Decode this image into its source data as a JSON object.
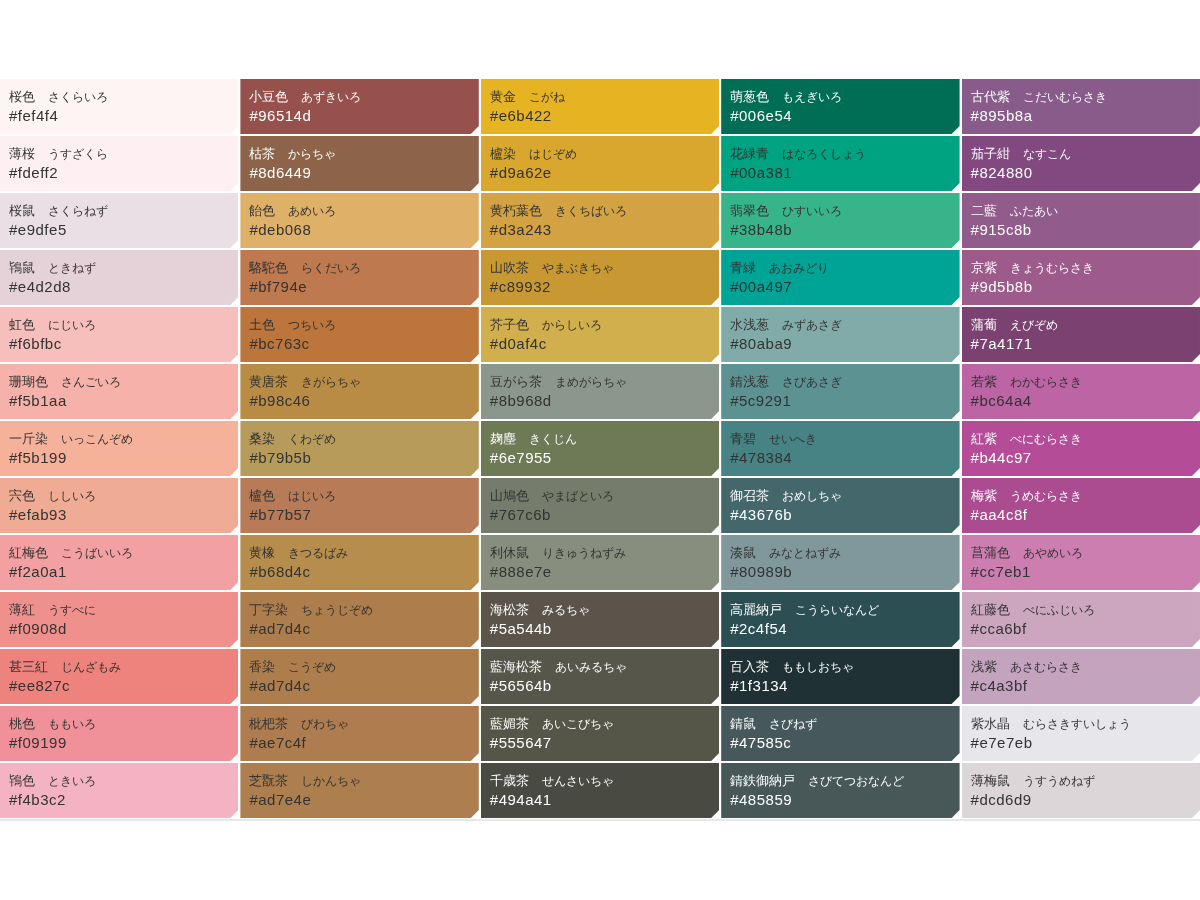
{
  "columns": [
    {
      "swatches": [
        {
          "name": "桜色",
          "reading": "さくらいろ",
          "hex": "#fef4f4",
          "color": "#fef4f4",
          "light_label": false
        },
        {
          "name": "薄桜",
          "reading": "うすざくら",
          "hex": "#fdeff2",
          "color": "#fdeff2",
          "light_label": false
        },
        {
          "name": "桜鼠",
          "reading": "さくらねず",
          "hex": "#e9dfe5",
          "color": "#e9dfe5",
          "light_label": false
        },
        {
          "name": "鴇鼠",
          "reading": "ときねず",
          "hex": "#e4d2d8",
          "color": "#e4d2d8",
          "light_label": false
        },
        {
          "name": "虹色",
          "reading": "にじいろ",
          "hex": "#f6bfbc",
          "color": "#f6bfbc",
          "light_label": false
        },
        {
          "name": "珊瑚色",
          "reading": "さんごいろ",
          "hex": "#f5b1aa",
          "color": "#f5b1aa",
          "light_label": false
        },
        {
          "name": "一斤染",
          "reading": "いっこんぞめ",
          "hex": "#f5b199",
          "color": "#f5b199",
          "light_label": false
        },
        {
          "name": "宍色",
          "reading": "ししいろ",
          "hex": "#efab93",
          "color": "#efab93",
          "light_label": false
        },
        {
          "name": "紅梅色",
          "reading": "こうばいいろ",
          "hex": "#f2a0a1",
          "color": "#f2a0a1",
          "light_label": false
        },
        {
          "name": "薄紅",
          "reading": "うすべに",
          "hex": "#f0908d",
          "color": "#f0908d",
          "light_label": false
        },
        {
          "name": "甚三紅",
          "reading": "じんざもみ",
          "hex": "#ee827c",
          "color": "#ee827c",
          "light_label": false
        },
        {
          "name": "桃色",
          "reading": "ももいろ",
          "hex": "#f09199",
          "color": "#f09199",
          "light_label": false
        },
        {
          "name": "鴇色",
          "reading": "ときいろ",
          "hex": "#f4b3c2",
          "color": "#f4b3c2",
          "light_label": false
        }
      ]
    },
    {
      "swatches": [
        {
          "name": "小豆色",
          "reading": "あずきいろ",
          "hex": "#96514d",
          "color": "#96514d",
          "light_label": true
        },
        {
          "name": "枯茶",
          "reading": "からちゃ",
          "hex": "#8d6449",
          "color": "#8d6449",
          "light_label": true
        },
        {
          "name": "飴色",
          "reading": "あめいろ",
          "hex": "#deb068",
          "color": "#deb068",
          "light_label": false
        },
        {
          "name": "駱駝色",
          "reading": "らくだいろ",
          "hex": "#bf794e",
          "color": "#bf794e",
          "light_label": false
        },
        {
          "name": "土色",
          "reading": "つちいろ",
          "hex": "#bc763c",
          "color": "#bc763c",
          "light_label": false
        },
        {
          "name": "黄唐茶",
          "reading": "きがらちゃ",
          "hex": "#b98c46",
          "color": "#b98c46",
          "light_label": false
        },
        {
          "name": "桑染",
          "reading": "くわぞめ",
          "hex": "#b79b5b",
          "color": "#b79b5b",
          "light_label": false
        },
        {
          "name": "櫨色",
          "reading": "はじいろ",
          "hex": "#b77b57",
          "color": "#b77b57",
          "light_label": false
        },
        {
          "name": "黄橡",
          "reading": "きつるばみ",
          "hex": "#b68d4c",
          "color": "#b68d4c",
          "light_label": false
        },
        {
          "name": "丁字染",
          "reading": "ちょうじぞめ",
          "hex": "#ad7d4c",
          "color": "#ad7d4c",
          "light_label": false
        },
        {
          "name": "香染",
          "reading": "こうぞめ",
          "hex": "#ad7d4c",
          "color": "#ad7d4c",
          "light_label": false
        },
        {
          "name": "枇杷茶",
          "reading": "びわちゃ",
          "hex": "#ae7c4f",
          "color": "#ae7c4f",
          "light_label": false
        },
        {
          "name": "芝翫茶",
          "reading": "しかんちゃ",
          "hex": "#ad7e4e",
          "color": "#ad7e4e",
          "light_label": false
        }
      ]
    },
    {
      "swatches": [
        {
          "name": "黄金",
          "reading": "こがね",
          "hex": "#e6b422",
          "color": "#e6b422",
          "light_label": false
        },
        {
          "name": "櫨染",
          "reading": "はじぞめ",
          "hex": "#d9a62e",
          "color": "#d9a62e",
          "light_label": false
        },
        {
          "name": "黄朽葉色",
          "reading": "きくちばいろ",
          "hex": "#d3a243",
          "color": "#d3a243",
          "light_label": false
        },
        {
          "name": "山吹茶",
          "reading": "やまぶきちゃ",
          "hex": "#c89932",
          "color": "#c89932",
          "light_label": false
        },
        {
          "name": "芥子色",
          "reading": "からしいろ",
          "hex": "#d0af4c",
          "color": "#d0af4c",
          "light_label": false
        },
        {
          "name": "豆がら茶",
          "reading": "まめがらちゃ",
          "hex": "#8b968d",
          "color": "#8b968d",
          "light_label": false
        },
        {
          "name": "麹塵",
          "reading": "きくじん",
          "hex": "#6e7955",
          "color": "#6e7955",
          "light_label": true
        },
        {
          "name": "山鳩色",
          "reading": "やまばといろ",
          "hex": "#767c6b",
          "color": "#767c6b",
          "light_label": false
        },
        {
          "name": "利休鼠",
          "reading": "りきゅうねずみ",
          "hex": "#888e7e",
          "color": "#888e7e",
          "light_label": false
        },
        {
          "name": "海松茶",
          "reading": "みるちゃ",
          "hex": "#5a544b",
          "color": "#5a544b",
          "light_label": true
        },
        {
          "name": "藍海松茶",
          "reading": "あいみるちゃ",
          "hex": "#56564b",
          "color": "#56564b",
          "light_label": true
        },
        {
          "name": "藍媚茶",
          "reading": "あいこびちゃ",
          "hex": "#555647",
          "color": "#555647",
          "light_label": true
        },
        {
          "name": "千歳茶",
          "reading": "せんさいちゃ",
          "hex": "#494a41",
          "color": "#494a41",
          "light_label": true
        }
      ]
    },
    {
      "swatches": [
        {
          "name": "萌葱色",
          "reading": "もえぎいろ",
          "hex": "#006e54",
          "color": "#006e54",
          "light_label": true
        },
        {
          "name": "花緑青",
          "reading": "はなろくしょう",
          "hex": "#00a381",
          "color": "#00a381",
          "light_label": false
        },
        {
          "name": "翡翠色",
          "reading": "ひすいいろ",
          "hex": "#38b48b",
          "color": "#38b48b",
          "light_label": false
        },
        {
          "name": "青緑",
          "reading": "あおみどり",
          "hex": "#00a497",
          "color": "#00a497",
          "light_label": false
        },
        {
          "name": "水浅葱",
          "reading": "みずあさぎ",
          "hex": "#80aba9",
          "color": "#80aba9",
          "light_label": false
        },
        {
          "name": "錆浅葱",
          "reading": "さびあさぎ",
          "hex": "#5c9291",
          "color": "#5c9291",
          "light_label": false
        },
        {
          "name": "青碧",
          "reading": "せいへき",
          "hex": "#478384",
          "color": "#478384",
          "light_label": false
        },
        {
          "name": "御召茶",
          "reading": "おめしちゃ",
          "hex": "#43676b",
          "color": "#43676b",
          "light_label": true
        },
        {
          "name": "湊鼠",
          "reading": "みなとねずみ",
          "hex": "#80989b",
          "color": "#80989b",
          "light_label": false
        },
        {
          "name": "高麗納戸",
          "reading": "こうらいなんど",
          "hex": "#2c4f54",
          "color": "#2c4f54",
          "light_label": true
        },
        {
          "name": "百入茶",
          "reading": "ももしおちゃ",
          "hex": "#1f3134",
          "color": "#1f3134",
          "light_label": true
        },
        {
          "name": "錆鼠",
          "reading": "さびねず",
          "hex": "#47585c",
          "color": "#47585c",
          "light_label": true
        },
        {
          "name": "錆鉄御納戸",
          "reading": "さびてつおなんど",
          "hex": "#485859",
          "color": "#485859",
          "light_label": true
        }
      ]
    },
    {
      "swatches": [
        {
          "name": "古代紫",
          "reading": "こだいむらさき",
          "hex": "#895b8a",
          "color": "#895b8a",
          "light_label": true
        },
        {
          "name": "茄子紺",
          "reading": "なすこん",
          "hex": "#824880",
          "color": "#824880",
          "light_label": true
        },
        {
          "name": "二藍",
          "reading": "ふたあい",
          "hex": "#915c8b",
          "color": "#915c8b",
          "light_label": true
        },
        {
          "name": "京紫",
          "reading": "きょうむらさき",
          "hex": "#9d5b8b",
          "color": "#9d5b8b",
          "light_label": true
        },
        {
          "name": "蒲葡",
          "reading": "えびぞめ",
          "hex": "#7a4171",
          "color": "#7a4171",
          "light_label": true
        },
        {
          "name": "若紫",
          "reading": "わかむらさき",
          "hex": "#bc64a4",
          "color": "#bc64a4",
          "light_label": false
        },
        {
          "name": "紅紫",
          "reading": "べにむらさき",
          "hex": "#b44c97",
          "color": "#b44c97",
          "light_label": true
        },
        {
          "name": "梅紫",
          "reading": "うめむらさき",
          "hex": "#aa4c8f",
          "color": "#aa4c8f",
          "light_label": true
        },
        {
          "name": "菖蒲色",
          "reading": "あやめいろ",
          "hex": "#cc7eb1",
          "color": "#cc7eb1",
          "light_label": false
        },
        {
          "name": "紅藤色",
          "reading": "べにふじいろ",
          "hex": "#cca6bf",
          "color": "#cca6bf",
          "light_label": false
        },
        {
          "name": "浅紫",
          "reading": "あさむらさき",
          "hex": "#c4a3bf",
          "color": "#c4a3bf",
          "light_label": false
        },
        {
          "name": "紫水晶",
          "reading": "むらさきすいしょう",
          "hex": "#e7e7eb",
          "color": "#e7e7eb",
          "light_label": false
        },
        {
          "name": "薄梅鼠",
          "reading": "うすうめねず",
          "hex": "#dcd6d9",
          "color": "#dcd6d9",
          "light_label": false
        }
      ]
    }
  ]
}
